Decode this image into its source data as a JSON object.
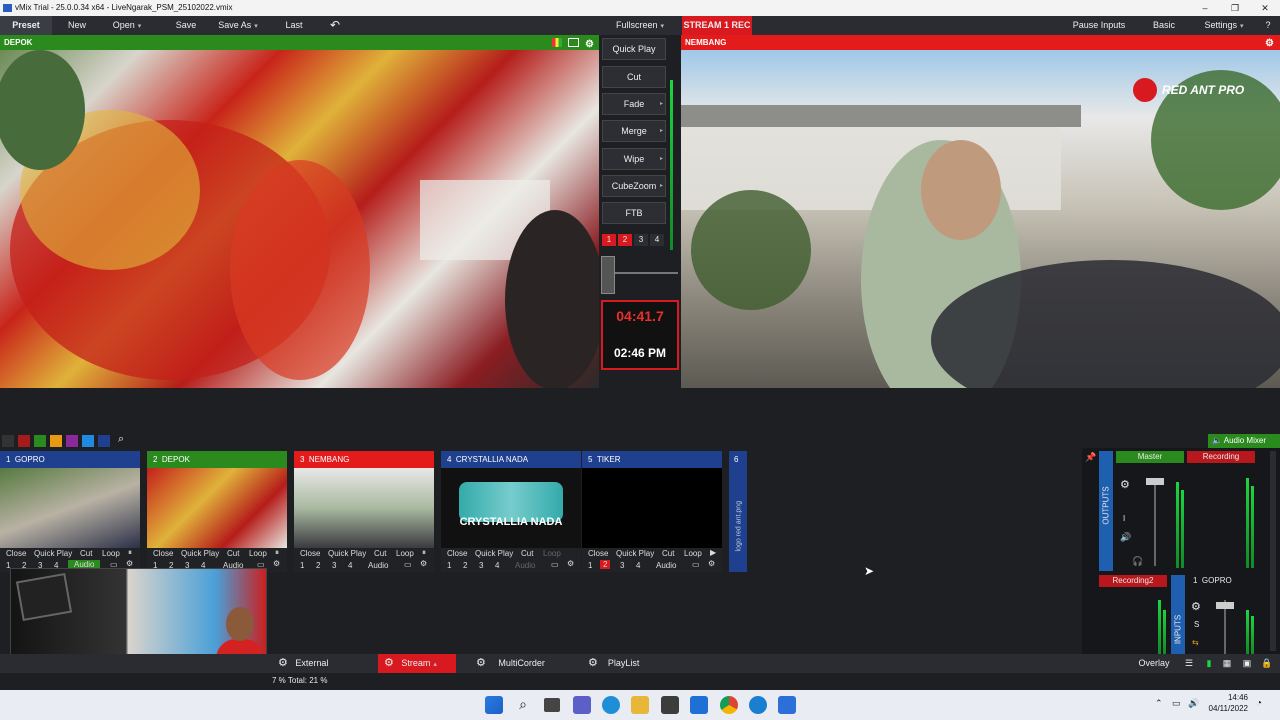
{
  "title": "vMix Trial - 25.0.0.34 x64 - LiveNgarak_PSM_25102022.vmix",
  "toolbar": {
    "preset": "Preset",
    "new": "New",
    "open": "Open",
    "save": "Save",
    "save_as": "Save As",
    "last": "Last",
    "fullscreen": "Fullscreen",
    "stream": "STREAM 1",
    "rec": "REC",
    "pause_inputs": "Pause Inputs",
    "basic": "Basic",
    "settings": "Settings",
    "help": "?"
  },
  "preview": {
    "label": "DEPOK"
  },
  "output": {
    "label": "NEMBANG",
    "watermark": "RED ANT PRO"
  },
  "transitions": {
    "quick_play": "Quick Play",
    "cut": "Cut",
    "fade": "Fade",
    "merge": "Merge",
    "wipe": "Wipe",
    "cubezoom": "CubeZoom",
    "ftb": "FTB",
    "numbers": [
      "1",
      "2",
      "3",
      "4"
    ]
  },
  "clock": {
    "countdown": "04:41.7",
    "time": "02:46 PM"
  },
  "inputs": [
    {
      "num": "1",
      "name": "GOPRO",
      "color": "#1f3f8f"
    },
    {
      "num": "2",
      "name": "DEPOK",
      "color": "#2a8a1e"
    },
    {
      "num": "3",
      "name": "NEMBANG",
      "color": "#d81920"
    },
    {
      "num": "4",
      "name": "CRYSTALLIA NADA",
      "color": "#1f3f8f"
    },
    {
      "num": "5",
      "name": "TIKER",
      "color": "#1f3f8f"
    },
    {
      "num": "6",
      "name": "",
      "color": "#1f3f8f"
    }
  ],
  "crystallia_title": "CRYSTALLIA NADA",
  "input6_side": "logo red ant.png",
  "ctrl": {
    "close": "Close",
    "quick_play": "Quick Play",
    "cut": "Cut",
    "loop": "Loop",
    "audio": "Audio",
    "nums": [
      "1",
      "2",
      "3",
      "4"
    ]
  },
  "audio_mixer": {
    "label": "Audio Mixer",
    "master": "Master",
    "recording": "Recording",
    "recording2": "Recording2",
    "outputs": "OUTPUTS",
    "inputs": "INPUTS",
    "gopro_num": "1",
    "gopro": "GOPRO",
    "i": "I",
    "s": "S"
  },
  "bottom": {
    "external": "External",
    "stream": "Stream",
    "multicorder": "MultiCorder",
    "playlist": "PlayList",
    "overlay": "Overlay",
    "cpu": "7 %  Total:  21 %"
  },
  "taskbar": {
    "time": "14:46",
    "date": "04/11/2022"
  },
  "colors": {
    "green": "#2a8a1e",
    "red": "#d81920",
    "blue": "#1f3f8f"
  }
}
